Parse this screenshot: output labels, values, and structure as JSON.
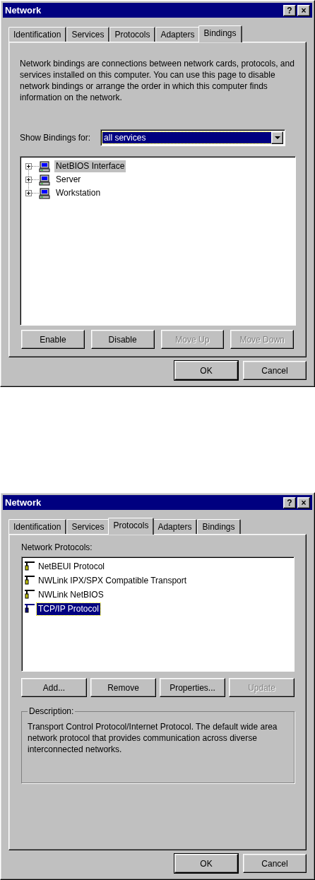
{
  "dialogs": [
    {
      "title": "Network",
      "title_buttons": [
        "?",
        "×"
      ],
      "tabs": [
        {
          "label": "Identification",
          "selected": false
        },
        {
          "label": "Services",
          "selected": false
        },
        {
          "label": "Protocols",
          "selected": false
        },
        {
          "label": "Adapters",
          "selected": false
        },
        {
          "label": "Bindings",
          "selected": true
        }
      ],
      "page": {
        "kind": "bindings",
        "description": "Network bindings are connections between network cards, protocols, and services installed on this computer.  You can use this page to disable network bindings or arrange the order in which this computer finds information on the network.",
        "show_for": {
          "label": "Show Bindings for:",
          "value": "all services"
        },
        "tree": [
          {
            "label": "NetBIOS Interface",
            "selected": true,
            "expanded": false
          },
          {
            "label": "Server",
            "selected": false,
            "expanded": false
          },
          {
            "label": "Workstation",
            "selected": false,
            "expanded": false
          }
        ],
        "buttons": [
          {
            "label": "Enable",
            "disabled": false
          },
          {
            "label": "Disable",
            "disabled": false
          },
          {
            "label": "Move Up",
            "disabled": true
          },
          {
            "label": "Move Down",
            "disabled": true
          }
        ]
      },
      "footer_buttons": [
        "OK",
        "Cancel"
      ]
    },
    {
      "title": "Network",
      "title_buttons": [
        "?",
        "×"
      ],
      "tabs": [
        {
          "label": "Identification",
          "selected": false
        },
        {
          "label": "Services",
          "selected": false
        },
        {
          "label": "Protocols",
          "selected": true
        },
        {
          "label": "Adapters",
          "selected": false
        },
        {
          "label": "Bindings",
          "selected": false
        }
      ],
      "page": {
        "kind": "protocols",
        "list_label": "Network Protocols:",
        "items": [
          {
            "label": "NetBEUI Protocol",
            "selected": false
          },
          {
            "label": "NWLink IPX/SPX Compatible Transport",
            "selected": false
          },
          {
            "label": "NWLink NetBIOS",
            "selected": false
          },
          {
            "label": "TCP/IP Protocol",
            "selected": true
          }
        ],
        "buttons": [
          {
            "label": "Add...",
            "disabled": false
          },
          {
            "label": "Remove",
            "disabled": false
          },
          {
            "label": "Properties...",
            "disabled": false
          },
          {
            "label": "Update",
            "disabled": true
          }
        ],
        "description_title": "Description:",
        "description": "Transport Control Protocol/Internet Protocol. The default wide area network protocol that provides communication across diverse interconnected networks."
      },
      "footer_buttons": [
        "OK",
        "Cancel"
      ]
    }
  ]
}
